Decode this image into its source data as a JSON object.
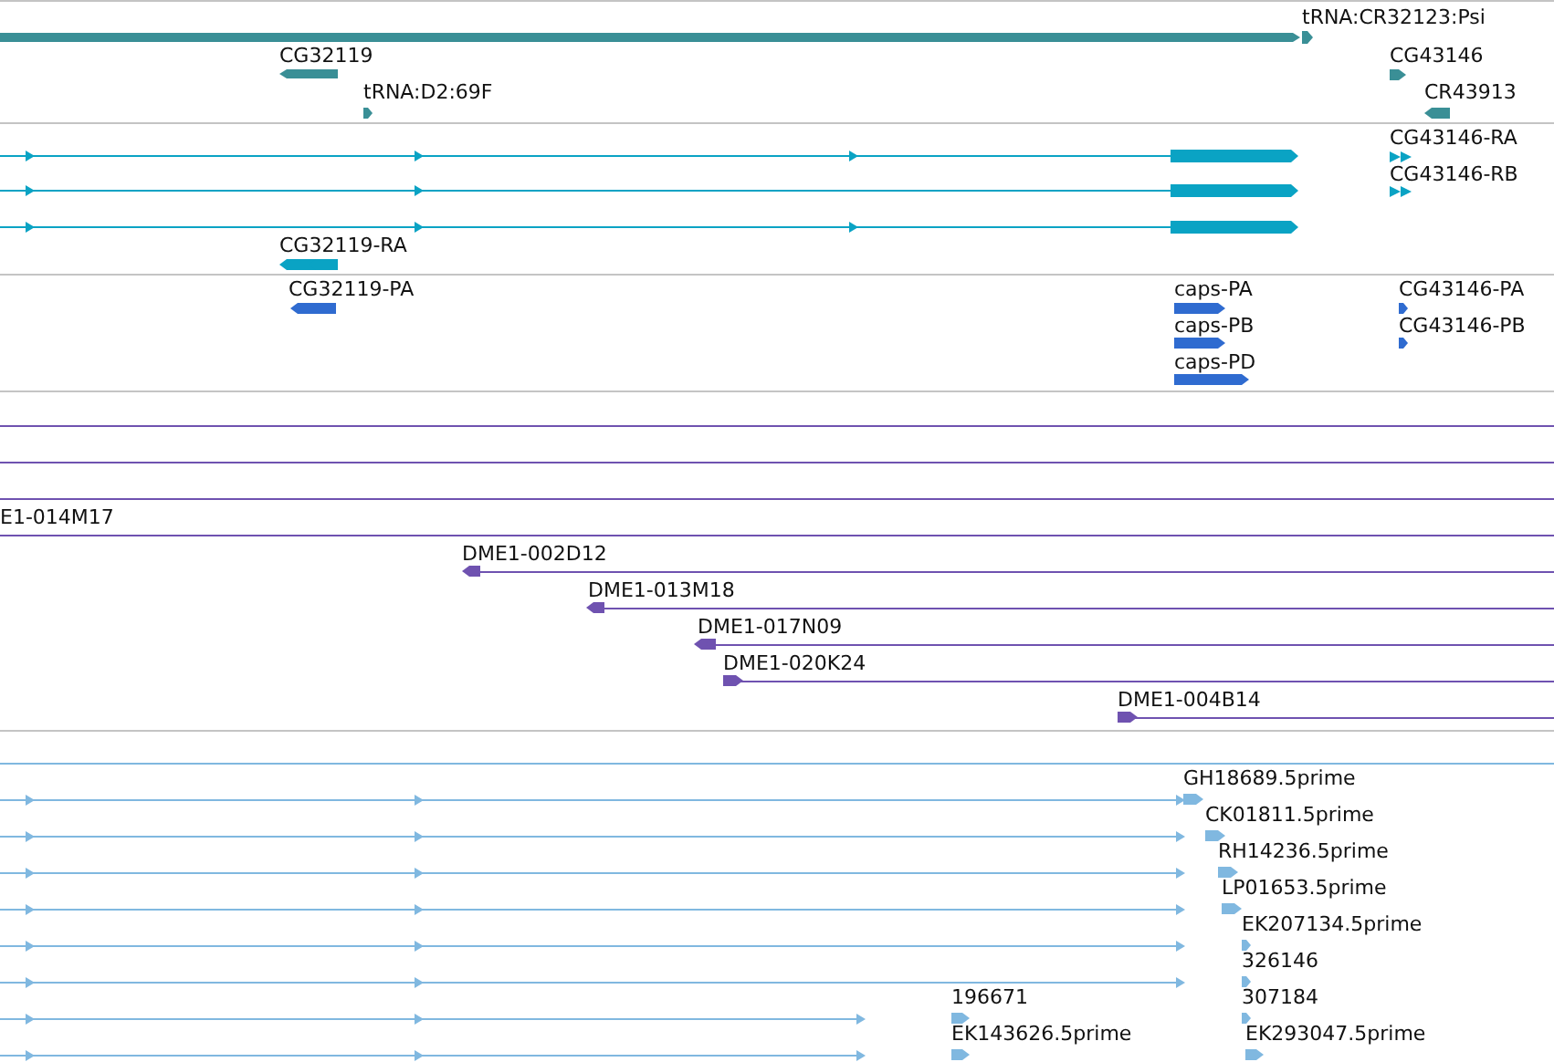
{
  "tracks": [
    {
      "kind": "gene",
      "features": [
        {
          "label": "tRNA:CR32123:Psi"
        },
        {
          "label": "CG32119"
        },
        {
          "label": "tRNA:D2:69F"
        },
        {
          "label": "CG43146"
        },
        {
          "label": "CR43913"
        }
      ]
    },
    {
      "kind": "transcript",
      "features": [
        {
          "label": "CG43146-RA"
        },
        {
          "label": "CG43146-RB"
        },
        {
          "label": "CG32119-RA"
        }
      ]
    },
    {
      "kind": "protein",
      "features": [
        {
          "label": "CG32119-PA"
        },
        {
          "label": "caps-PA"
        },
        {
          "label": "CG43146-PA"
        },
        {
          "label": "caps-PB"
        },
        {
          "label": "CG43146-PB"
        },
        {
          "label": "caps-PD"
        }
      ]
    },
    {
      "kind": "clone",
      "features": [
        {
          "label": "E1-014M17"
        },
        {
          "label": "DME1-002D12"
        },
        {
          "label": "DME1-013M18"
        },
        {
          "label": "DME1-017N09"
        },
        {
          "label": "DME1-020K24"
        },
        {
          "label": "DME1-004B14"
        }
      ]
    },
    {
      "kind": "est",
      "features": [
        {
          "label": "GH18689.5prime"
        },
        {
          "label": "CK01811.5prime"
        },
        {
          "label": "RH14236.5prime"
        },
        {
          "label": "LP01653.5prime"
        },
        {
          "label": "EK207134.5prime"
        },
        {
          "label": "326146"
        },
        {
          "label": "196671"
        },
        {
          "label": "307184"
        },
        {
          "label": "EK143626.5prime"
        },
        {
          "label": "EK293047.5prime"
        }
      ]
    }
  ]
}
